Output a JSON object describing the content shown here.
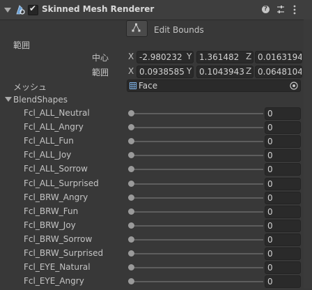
{
  "component": {
    "title": "Skinned Mesh Renderer",
    "enabled": true
  },
  "edit_bounds": {
    "label": "Edit Bounds"
  },
  "bounds": {
    "label": "範囲",
    "center": {
      "label": "中心",
      "x_label": "X",
      "x": "-2.980232",
      "y_label": "Y",
      "y": "1.361482",
      "z_label": "Z",
      "z": "0.0163194"
    },
    "extent": {
      "label": "範囲",
      "x_label": "X",
      "x": "0.0938585",
      "y_label": "Y",
      "y": "0.1043943",
      "z_label": "Z",
      "z": "0.0648104"
    }
  },
  "mesh": {
    "label": "メッシュ",
    "value": "Face"
  },
  "blendshapes": {
    "label": "BlendShapes",
    "items": [
      {
        "name": "Fcl_ALL_Neutral",
        "value": "0",
        "level": 0
      },
      {
        "name": "Fcl_ALL_Angry",
        "value": "0",
        "level": 0
      },
      {
        "name": "Fcl_ALL_Fun",
        "value": "0",
        "level": 0
      },
      {
        "name": "Fcl_ALL_Joy",
        "value": "0",
        "level": 0
      },
      {
        "name": "Fcl_ALL_Sorrow",
        "value": "0",
        "level": 0
      },
      {
        "name": "Fcl_ALL_Surprised",
        "value": "0",
        "level": 0
      },
      {
        "name": "Fcl_BRW_Angry",
        "value": "0",
        "level": 0
      },
      {
        "name": "Fcl_BRW_Fun",
        "value": "0",
        "level": 0
      },
      {
        "name": "Fcl_BRW_Joy",
        "value": "0",
        "level": 0
      },
      {
        "name": "Fcl_BRW_Sorrow",
        "value": "0",
        "level": 0
      },
      {
        "name": "Fcl_BRW_Surprised",
        "value": "0",
        "level": 0
      },
      {
        "name": "Fcl_EYE_Natural",
        "value": "0",
        "level": 0
      },
      {
        "name": "Fcl_EYE_Angry",
        "value": "0",
        "level": 0
      }
    ]
  },
  "icons": {
    "foldout": "triangle-down-icon",
    "component": "skinned-mesh-icon",
    "help": "help-icon",
    "settings": "sliders-icon",
    "menu": "kebab-menu-icon",
    "edit_bounds": "bounds-handle-icon",
    "mesh": "mesh-grid-icon",
    "object_picker": "target-icon"
  }
}
